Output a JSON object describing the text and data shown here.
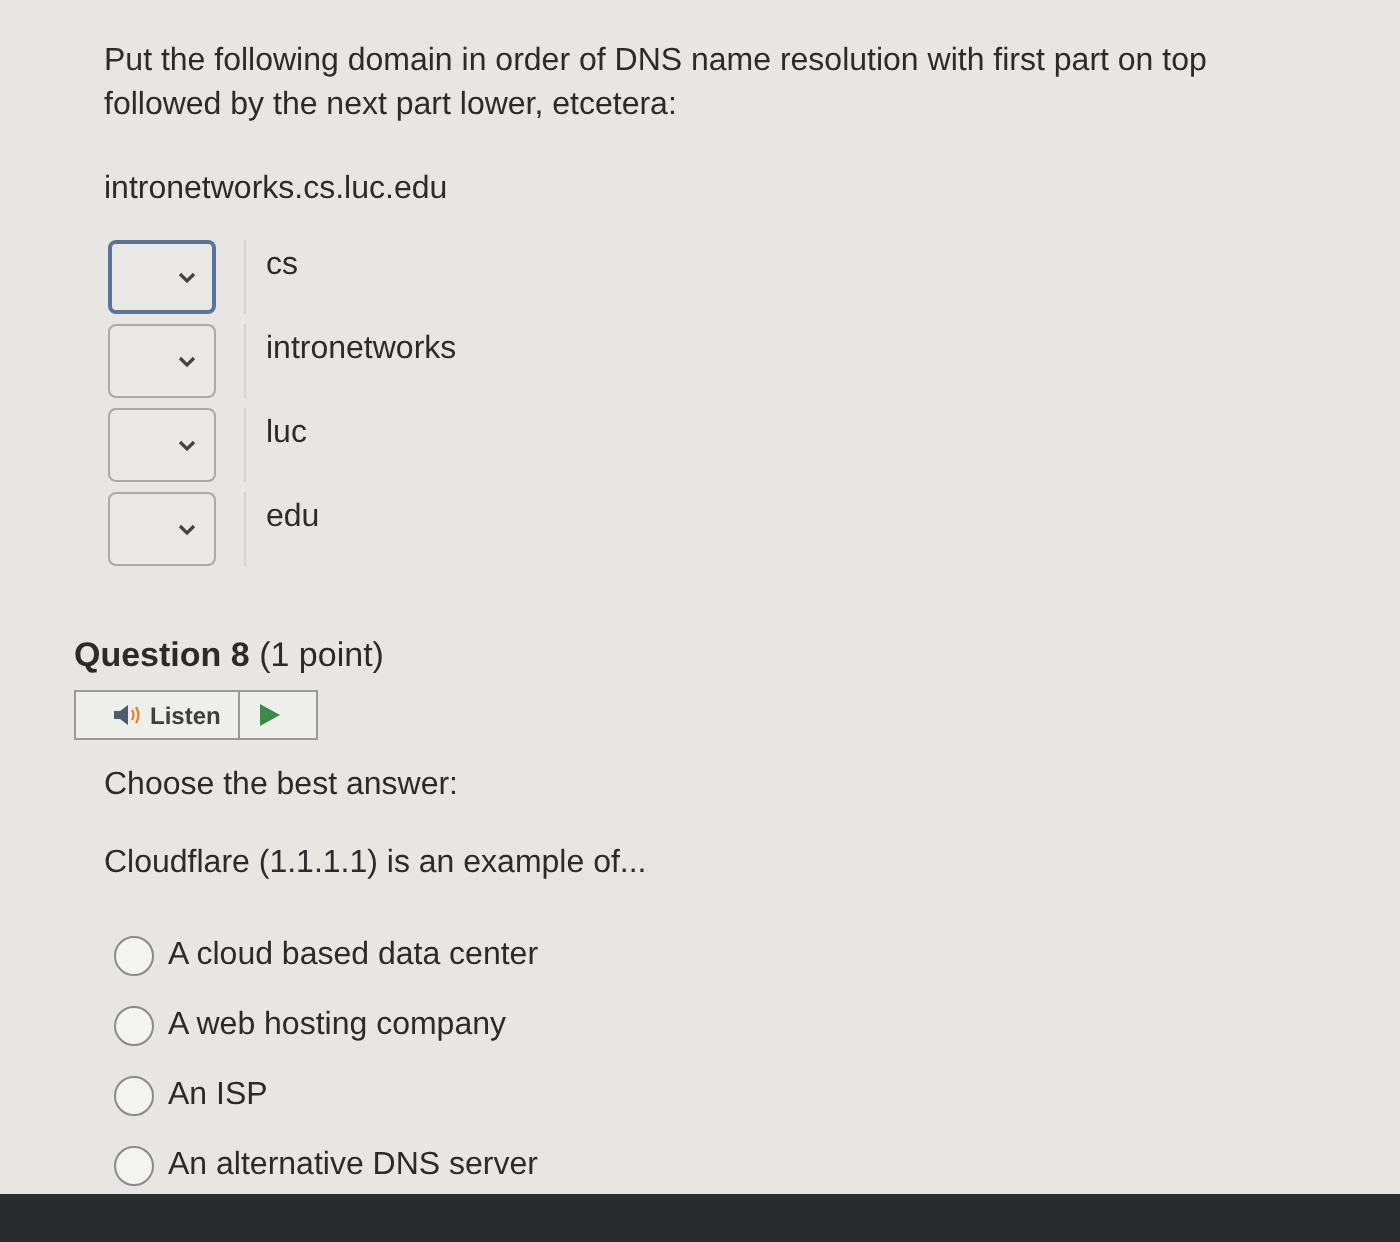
{
  "question_7": {
    "prompt": "Put the following domain in order of DNS name resolution with first part on top followed by the next part lower, etcetera:",
    "domain": "intronetworks.cs.luc.edu",
    "items": [
      {
        "label": "cs",
        "focused": true
      },
      {
        "label": "intronetworks",
        "focused": false
      },
      {
        "label": "luc",
        "focused": false
      },
      {
        "label": "edu",
        "focused": false
      }
    ]
  },
  "question_8": {
    "title": "Question 8",
    "points": "(1 point)",
    "listen_button": "Listen",
    "instruction": "Choose the best answer:",
    "stem": "Cloudflare (1.1.1.1) is an example of...",
    "options": [
      {
        "label": "A cloud based data center",
        "selected": false
      },
      {
        "label": "A web hosting company",
        "selected": false
      },
      {
        "label": "An ISP",
        "selected": false
      },
      {
        "label": "An alternative DNS server",
        "selected": false
      }
    ]
  }
}
